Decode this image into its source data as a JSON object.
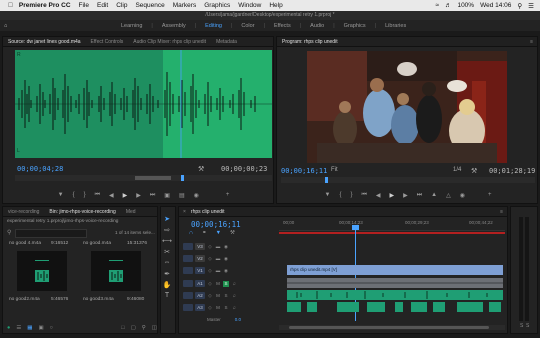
{
  "menubar": {
    "app_name": "Premiere Pro CC",
    "items": [
      "File",
      "Edit",
      "Clip",
      "Sequence",
      "Markers",
      "Graphics",
      "Window",
      "Help"
    ],
    "clock": "Wed 14:06",
    "battery": "100%"
  },
  "window": {
    "path": "/Users/jama/jgardner/Desktop/experimental retry 1.prproj *"
  },
  "workspaces": {
    "items": [
      "Learning",
      "Assembly",
      "Editing",
      "Color",
      "Effects",
      "Audio",
      "Graphics",
      "Libraries"
    ],
    "active": "Editing"
  },
  "source_panel": {
    "tabs": [
      "Source: dw janet lines good.m4a",
      "Effect Controls",
      "Audio Clip Mixer: rhps clip unedit",
      "Metadata"
    ],
    "timecode_in": "00;00;04;28",
    "timecode_dur": "00;00;00;23",
    "label_top": "R",
    "label_bottom": "L"
  },
  "program_panel": {
    "tab": "Program: rhps clip unedit",
    "timecode_in": "00;00;16;11",
    "fit": "Fit",
    "scale": "1/4",
    "timecode_dur": "00;01;28;19"
  },
  "project_panel": {
    "tabs": [
      "vice-recording",
      "Bin: jimo-rhps-voice-recording",
      "Med"
    ],
    "project_name": "experimental retry 1.prproj\\jimo-rhps-voice-recording",
    "items_count": "1 of 14 items sele...",
    "clips": [
      {
        "name": "no good 4.m4a",
        "duration": "9:16512"
      },
      {
        "name": "no good.m4a",
        "duration": "15:31376"
      },
      {
        "name": "no good2.m4a",
        "duration": "5:46576"
      },
      {
        "name": "no good3.m4a",
        "duration": "9:46080"
      }
    ]
  },
  "timeline": {
    "tab": "rhps clip unedit",
    "timecode": "00;00;16;11",
    "ruler": [
      "00;00",
      "00;00;14;23",
      "00;00;29;23",
      "00;00;44;22"
    ],
    "tracks_video": [
      "V3",
      "V2",
      "V1"
    ],
    "tracks_audio": [
      "A1",
      "A2",
      "A3"
    ],
    "master_label": "Master",
    "master_value": "0.0",
    "clip_label": "rhps clip unedit.mp4 [V]"
  },
  "colors": {
    "accent": "#4aa3ff",
    "source_green": "#1e8f60",
    "audio_clip": "#1f9e74",
    "video_clip": "#7e9fd4"
  }
}
